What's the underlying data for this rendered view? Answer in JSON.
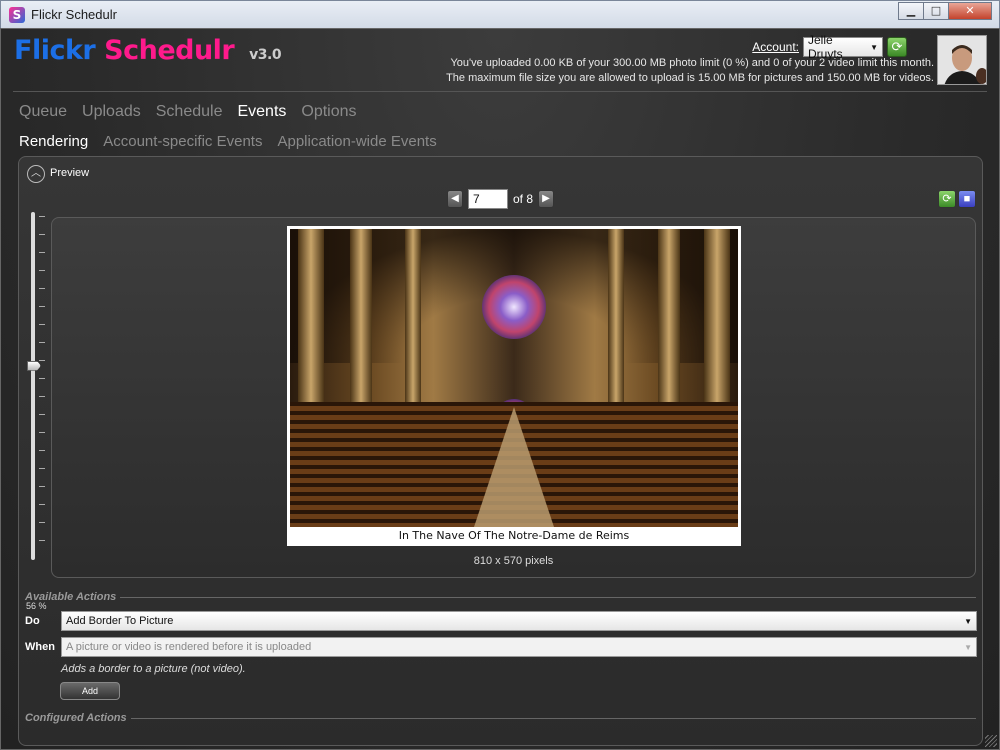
{
  "window": {
    "title": "Flickr Schedulr",
    "icon_letter": "S"
  },
  "header": {
    "logo_part1": "Flickr",
    "logo_part2": "Schedulr",
    "version": "v3.0",
    "account_label": "Account:",
    "account_value": "Jelle Druyts",
    "info_line1": "You've uploaded 0.00 KB of your 300.00 MB photo limit (0 %) and 0 of your 2 video limit this month.",
    "info_line2": "The maximum file size you are allowed to upload is 15.00 MB for pictures and 150.00 MB for videos."
  },
  "nav": {
    "main": [
      "Queue",
      "Uploads",
      "Schedule",
      "Events",
      "Options"
    ],
    "main_active": "Events",
    "sub": [
      "Rendering",
      "Account-specific Events",
      "Application-wide Events"
    ],
    "sub_active": "Rendering"
  },
  "preview": {
    "label": "Preview",
    "page_value": "7",
    "page_of": "of 8",
    "zoom_percent_label": "56 %",
    "zoom_fraction": 0.56,
    "caption": "In The Nave Of The Notre-Dame de Reims",
    "dimensions": "810 x 570 pixels"
  },
  "actions": {
    "available_header": "Available Actions",
    "do_label": "Do",
    "do_value": "Add Border To Picture",
    "when_label": "When",
    "when_value": "A picture or video is rendered before it is uploaded",
    "description": "Adds a border to a picture (not video).",
    "add_label": "Add",
    "configured_header": "Configured Actions"
  },
  "colors": {
    "brand_blue": "#1c6fe6",
    "brand_pink": "#ff1a8c",
    "background": "#2a2a2a"
  },
  "icons": [
    "app-icon",
    "minimize-icon",
    "maximize-icon",
    "close-icon",
    "refresh-icon",
    "collapse-icon",
    "previous-icon",
    "next-icon",
    "refresh-icon",
    "save-icon",
    "dropdown-icon"
  ]
}
